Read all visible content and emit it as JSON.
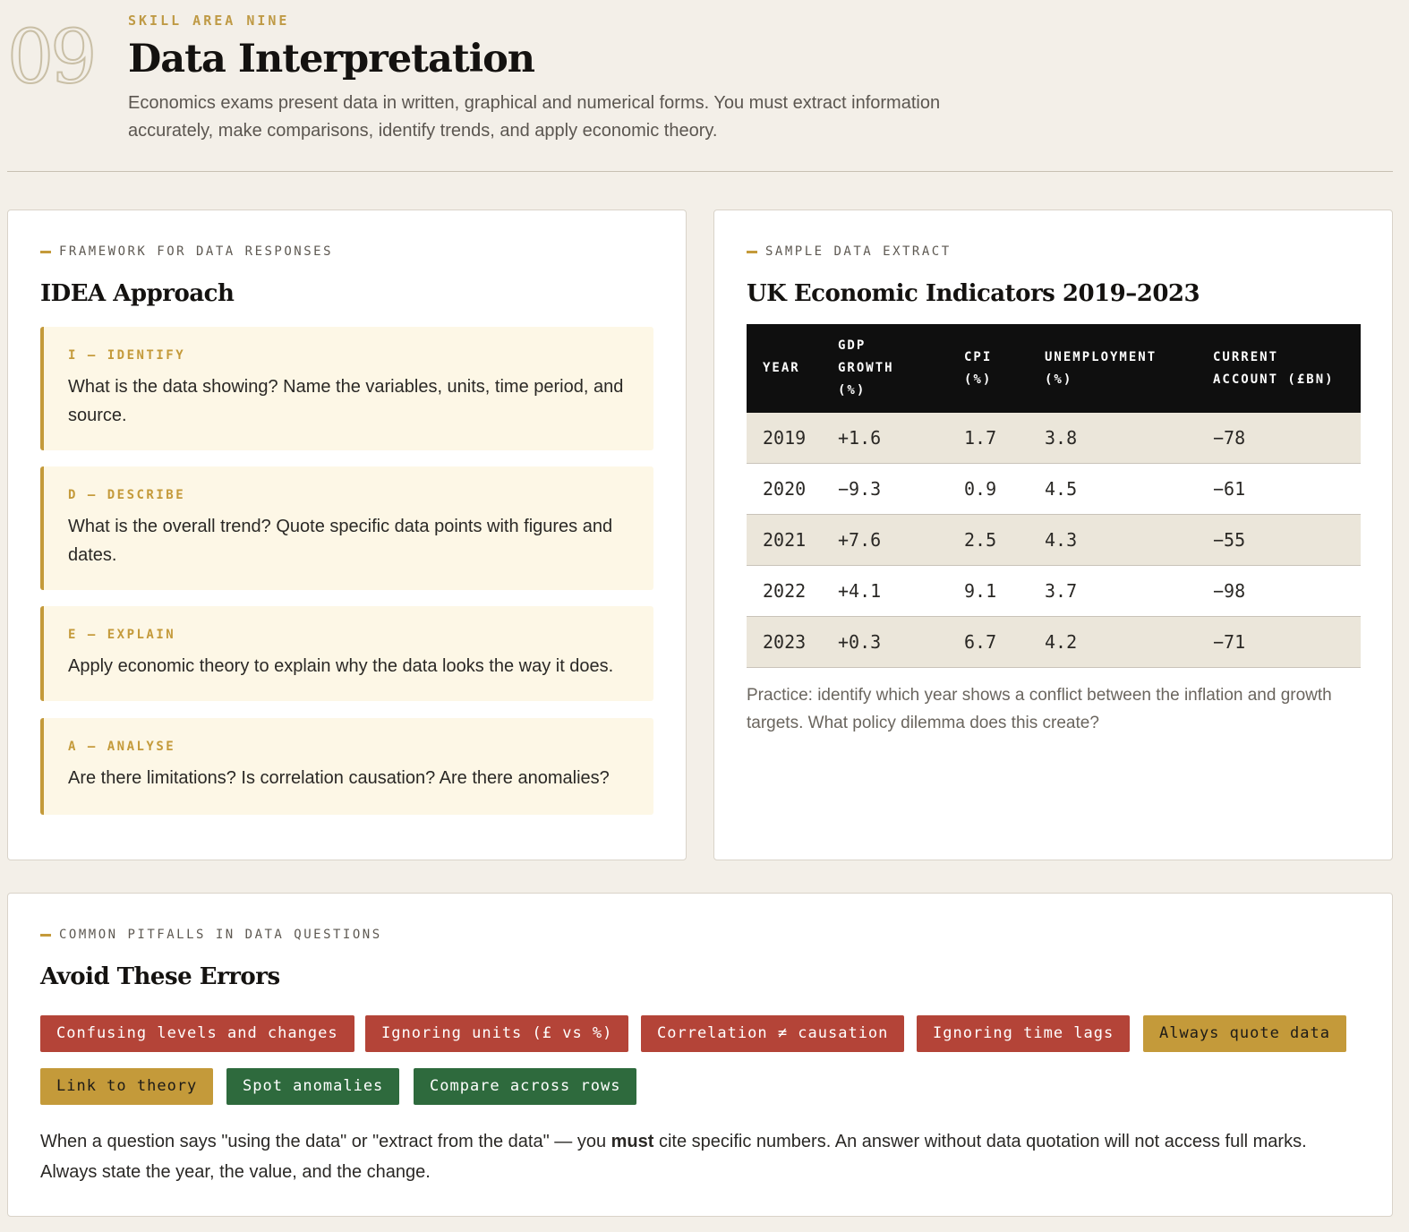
{
  "header": {
    "number": "09",
    "eyebrow": "SKILL AREA NINE",
    "title": "Data Interpretation",
    "intro": "Economics exams present data in written, graphical and numerical forms. You must extract information accurately, make comparisons, identify trends, and apply economic theory."
  },
  "framework": {
    "label": "FRAMEWORK FOR DATA RESPONSES",
    "title": "IDEA Approach",
    "steps": [
      {
        "label": "I — IDENTIFY",
        "text": "What is the data showing? Name the variables, units, time period, and source."
      },
      {
        "label": "D — DESCRIBE",
        "text": "What is the overall trend? Quote specific data points with figures and dates."
      },
      {
        "label": "E — EXPLAIN",
        "text": "Apply economic theory to explain why the data looks the way it does."
      },
      {
        "label": "A — ANALYSE",
        "text": "Are there limitations? Is correlation causation? Are there anomalies?"
      }
    ]
  },
  "sample": {
    "label": "SAMPLE DATA EXTRACT",
    "title": "UK Economic Indicators 2019–2023",
    "columns": [
      "YEAR",
      "GDP GROWTH (%)",
      "CPI (%)",
      "UNEMPLOYMENT (%)",
      "CURRENT ACCOUNT (£BN)"
    ],
    "rows": [
      [
        "2019",
        "+1.6",
        "1.7",
        "3.8",
        "−78"
      ],
      [
        "2020",
        "−9.3",
        "0.9",
        "4.5",
        "−61"
      ],
      [
        "2021",
        "+7.6",
        "2.5",
        "4.3",
        "−55"
      ],
      [
        "2022",
        "+4.1",
        "9.1",
        "3.7",
        "−98"
      ],
      [
        "2023",
        "+0.3",
        "6.7",
        "4.2",
        "−71"
      ]
    ],
    "practice": "Practice: identify which year shows a conflict between the inflation and growth targets. What policy dilemma does this create?"
  },
  "pitfalls": {
    "label": "COMMON PITFALLS IN DATA QUESTIONS",
    "title": "Avoid These Errors",
    "tags": [
      {
        "text": "Confusing levels and changes",
        "tone": "red"
      },
      {
        "text": "Ignoring units (£ vs %)",
        "tone": "red"
      },
      {
        "text": "Correlation ≠ causation",
        "tone": "red"
      },
      {
        "text": "Ignoring time lags",
        "tone": "red"
      },
      {
        "text": "Always quote data",
        "tone": "gold"
      },
      {
        "text": "Link to theory",
        "tone": "gold"
      },
      {
        "text": "Spot anomalies",
        "tone": "green"
      },
      {
        "text": "Compare across rows",
        "tone": "green"
      }
    ],
    "note_before": "When a question says \"using the data\" or \"extract from the data\" — you ",
    "note_bold": "must",
    "note_after": " cite specific numbers. An answer without data quotation will not access full marks. Always state the year, the value, and the change."
  },
  "colors": {
    "accent": "#c49a3a",
    "red": "#b44438",
    "green": "#2e6a3d",
    "page": "#f3efe8"
  }
}
